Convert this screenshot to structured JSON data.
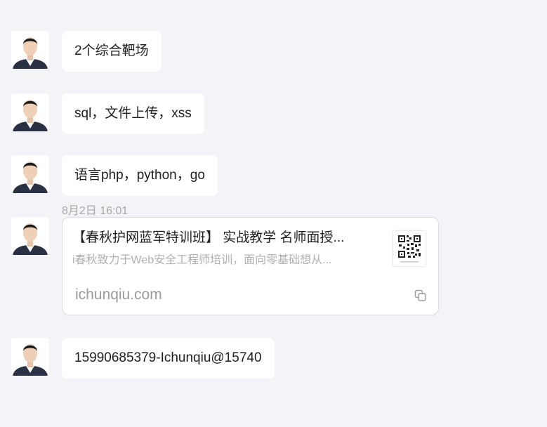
{
  "messages": [
    {
      "text": "2个综合靶场"
    },
    {
      "text": "sql，文件上传，xss"
    },
    {
      "text": "语言php，python，go"
    },
    {
      "text": "15990685379-Ichunqiu@15740"
    }
  ],
  "timestamp": "8月2日 16:01",
  "link_card": {
    "title": "【春秋护网蓝军特训班】 实战教学  名师面授...",
    "description": "i春秋致力于Web安全工程师培训，面向零基础想从...",
    "source": "ichunqiu.com",
    "thumbnail": "qr-code-icon",
    "copy_icon": "copy-icon"
  },
  "colors": {
    "background": "#f3f4f7",
    "bubble": "#ffffff",
    "text": "#1f1f1f",
    "muted": "#a8a8a8"
  }
}
